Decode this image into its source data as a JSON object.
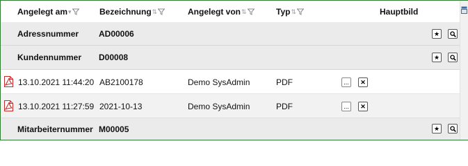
{
  "columns": {
    "angelegt_am": "Angelegt am",
    "bezeichnung": "Bezeichnung",
    "angelegt_von": "Angelegt von",
    "typ": "Typ",
    "hauptbild": "Hauptbild"
  },
  "groups": [
    {
      "label": "Adressnummer",
      "value": "AD00006"
    },
    {
      "label": "Kundennummer",
      "value": "D00008"
    },
    {
      "label": "Mitarbeiternummer",
      "value": "M00005"
    }
  ],
  "rows": [
    {
      "date": "13.10.2021 11:44:20",
      "bezeichnung": "AB2100178",
      "user": "Demo SysAdmin",
      "typ": "PDF",
      "icon": "pdf-file-icon"
    },
    {
      "date": "13.10.2021 11:27:59",
      "bezeichnung": "2021-10-13",
      "user": "Demo SysAdmin",
      "typ": "PDF",
      "icon": "pdf-file-icon"
    }
  ],
  "buttons": {
    "more": "...",
    "delete": "✕",
    "pin": "★"
  },
  "colors": {
    "frame_border": "#2e7d32",
    "group_bg": "#ebebeb",
    "pdf_red": "#c62828"
  }
}
